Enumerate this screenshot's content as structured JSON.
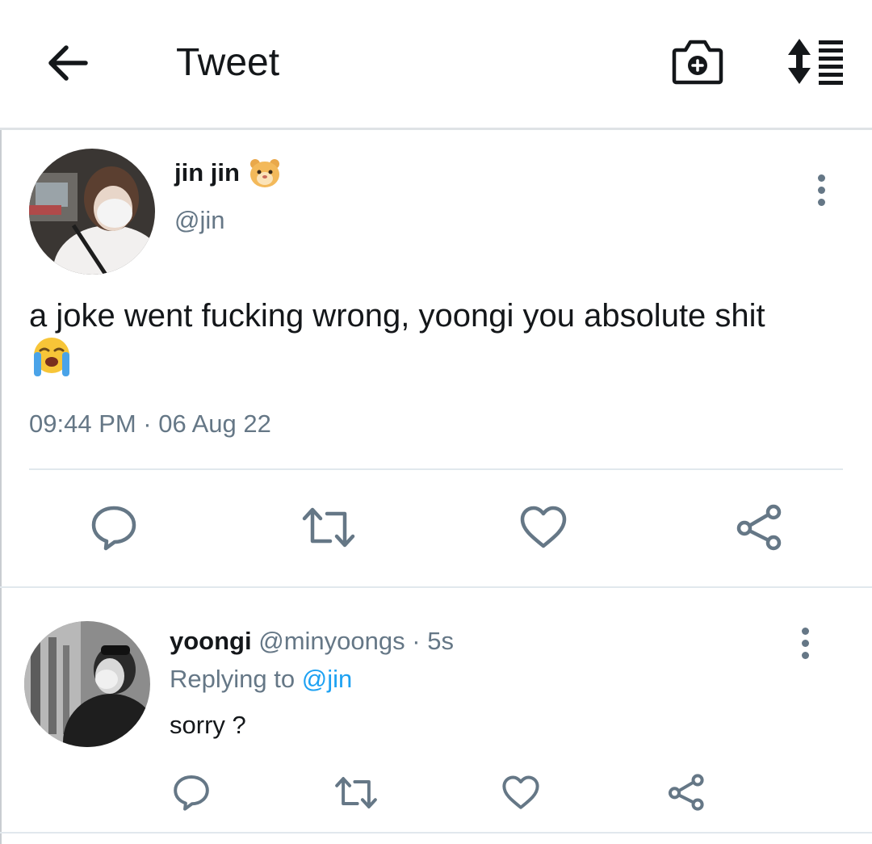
{
  "header": {
    "title": "Tweet",
    "back_icon": "arrow-left-icon",
    "camera_icon": "camera-plus-icon",
    "sort_icon": "sort-list-icon"
  },
  "tweet": {
    "display_name": "jin jin",
    "name_emoji": "🐹",
    "handle": "@jin",
    "text": "a joke went fucking wrong, yoongi you absolute shit",
    "text_emoji": "😭",
    "timestamp": "09:44 PM · 06 Aug 22",
    "actions": [
      "reply-icon",
      "retweet-icon",
      "like-icon",
      "share-icon"
    ]
  },
  "reply": {
    "display_name": "yoongi",
    "handle": "@minyoongs",
    "separator": "·",
    "time": "5s",
    "replying_prefix": "Replying to",
    "replying_to": "@jin",
    "text": "sorry ?",
    "actions": [
      "reply-icon",
      "retweet-icon",
      "like-icon",
      "share-icon"
    ]
  },
  "colors": {
    "text": "#14171a",
    "secondary": "#657786",
    "accent": "#1da1f2",
    "divider": "#e1e8ed",
    "icon": "#657786"
  }
}
